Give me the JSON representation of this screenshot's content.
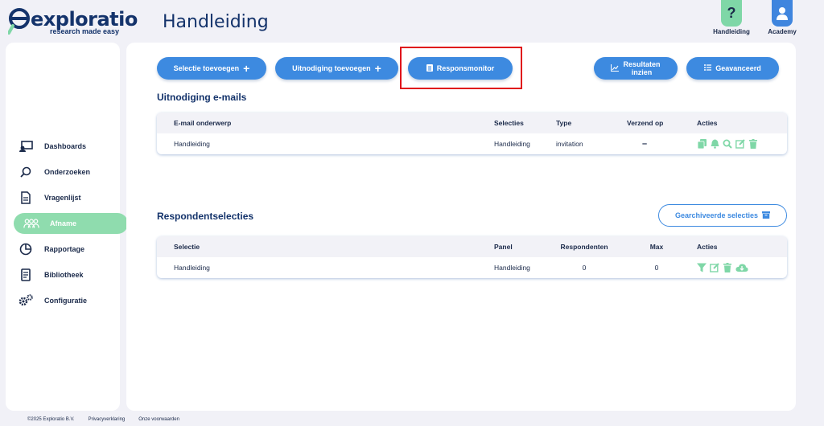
{
  "brand": {
    "name": "exploratio",
    "tagline": "research made easy"
  },
  "header": {
    "title": "Handleiding",
    "help": {
      "icon": "question-icon",
      "label": "Handleiding",
      "glyph": "?"
    },
    "academy": {
      "icon": "user-icon",
      "label": "Academy"
    }
  },
  "sidebar": {
    "items": [
      {
        "label": "Dashboards",
        "icon": "dashboard-icon"
      },
      {
        "label": "Onderzoeken",
        "icon": "search-icon"
      },
      {
        "label": "Vragenlijst",
        "icon": "document-icon"
      },
      {
        "label": "Afname",
        "icon": "users-icon",
        "active": true
      },
      {
        "label": "Rapportage",
        "icon": "pie-chart-icon"
      },
      {
        "label": "Bibliotheek",
        "icon": "book-icon"
      },
      {
        "label": "Configuratie",
        "icon": "gears-icon"
      }
    ]
  },
  "toolbar": {
    "add_selection": "Selectie toevoegen",
    "add_invitation": "Uitnodiging toevoegen",
    "response_monitor": "Responsmonitor",
    "view_results_line1": "Resultaten",
    "view_results_line2": "inzien",
    "advanced": "Geavanceerd"
  },
  "invitations": {
    "title": "Uitnodiging e-mails",
    "columns": [
      "E-mail onderwerp",
      "Selecties",
      "Type",
      "Verzend op",
      "Acties"
    ],
    "rows": [
      {
        "subject": "Handleiding",
        "selections": "Handleiding",
        "type": "invitation",
        "send_on": "–"
      }
    ],
    "actions": [
      "copy-icon",
      "bell-icon",
      "search-icon",
      "edit-icon",
      "trash-icon"
    ]
  },
  "selections": {
    "title": "Respondentselecties",
    "archived_button": "Gearchiveerde selecties",
    "columns": [
      "Selectie",
      "Panel",
      "Respondenten",
      "Max",
      "Acties"
    ],
    "rows": [
      {
        "selection": "Handleiding",
        "panel": "Handleiding",
        "respondents": "0",
        "max": "0"
      }
    ],
    "actions": [
      "filter-icon",
      "edit-icon",
      "trash-icon",
      "cloud-download-icon"
    ]
  },
  "footer": {
    "copyright": "©2025 Exploratio B.V.",
    "privacy": "Privacyverklaring",
    "terms": "Onze voorwaarden"
  },
  "colors": {
    "primary": "#3d8ae0",
    "accent_green": "#7fd7a7",
    "navy": "#14336b",
    "highlight": "#e0131b",
    "background": "#f1f1f7"
  }
}
